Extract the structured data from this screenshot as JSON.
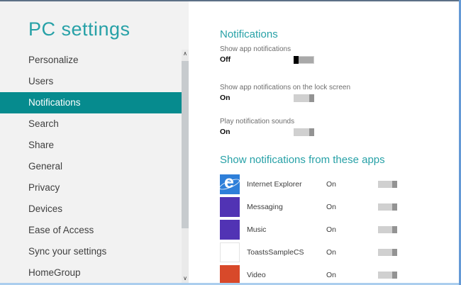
{
  "sidebar": {
    "title": "PC settings",
    "items": [
      {
        "label": "Personalize",
        "selected": false
      },
      {
        "label": "Users",
        "selected": false
      },
      {
        "label": "Notifications",
        "selected": true
      },
      {
        "label": "Search",
        "selected": false
      },
      {
        "label": "Share",
        "selected": false
      },
      {
        "label": "General",
        "selected": false
      },
      {
        "label": "Privacy",
        "selected": false
      },
      {
        "label": "Devices",
        "selected": false
      },
      {
        "label": "Ease of Access",
        "selected": false
      },
      {
        "label": "Sync your settings",
        "selected": false
      },
      {
        "label": "HomeGroup",
        "selected": false
      }
    ]
  },
  "scrollbar": {
    "up_icon": "∧",
    "down_icon": "∨"
  },
  "content": {
    "heading": "Notifications",
    "settings": [
      {
        "label": "Show app notifications",
        "value": "Off",
        "state": "off"
      },
      {
        "label": "Show app notifications on the lock screen",
        "value": "On",
        "state": "on"
      },
      {
        "label": "Play notification sounds",
        "value": "On",
        "state": "on"
      }
    ],
    "apps_heading": "Show notifications from these apps",
    "apps": [
      {
        "name": "Internet Explorer",
        "value": "On",
        "state": "on",
        "tile_color": "#2e7fd9",
        "icon": "internet-explorer-logo"
      },
      {
        "name": "Messaging",
        "value": "On",
        "state": "on",
        "tile_color": "#5133b4",
        "icon": "messaging-tile"
      },
      {
        "name": "Music",
        "value": "On",
        "state": "on",
        "tile_color": "#5133b4",
        "icon": "music-tile"
      },
      {
        "name": "ToastsSampleCS",
        "value": "On",
        "state": "on",
        "tile_color": "#ffffff",
        "icon": "toastssamplecs-tile"
      },
      {
        "name": "Video",
        "value": "On",
        "state": "on",
        "tile_color": "#d8492a",
        "icon": "video-tile"
      }
    ]
  },
  "colors": {
    "accent_heading": "#27a1a7",
    "selection_teal": "#068b8e",
    "sidebar_bg": "#f2f2f2",
    "border_top": "#5c7086",
    "border_right": "#659ad6",
    "border_bottom": "#abceee",
    "toggle_off_thumb": "#000000",
    "toggle_on_thumb": "#939393"
  }
}
